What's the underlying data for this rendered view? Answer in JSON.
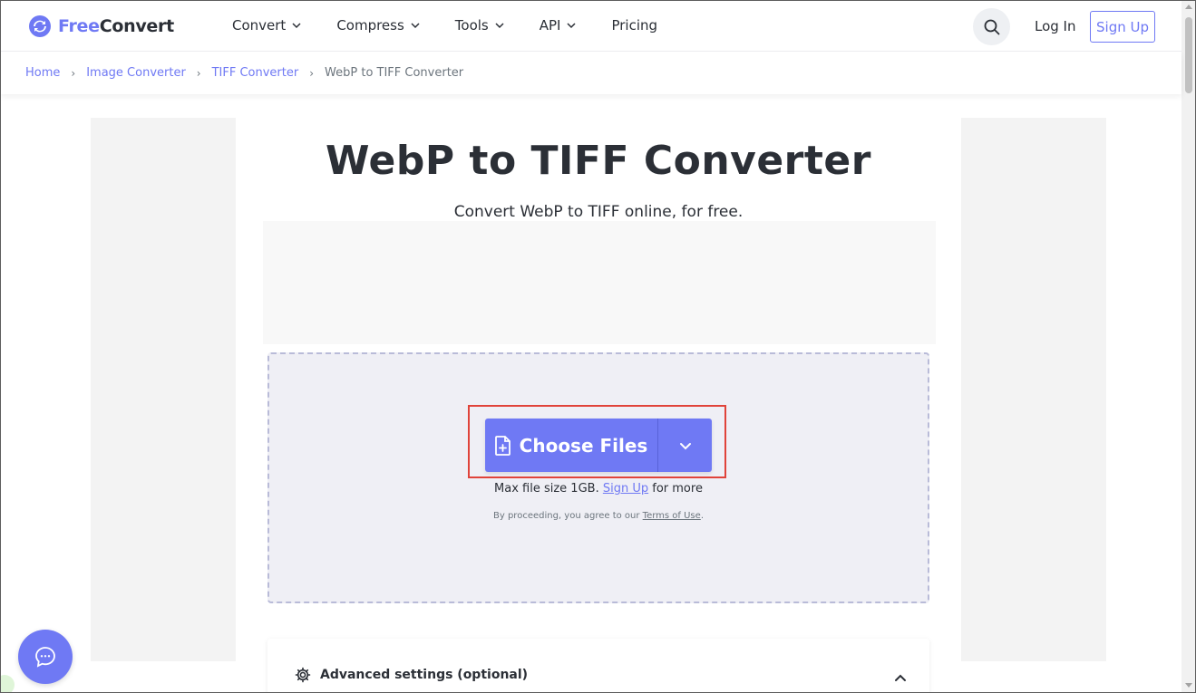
{
  "brand": {
    "name_part1": "Free",
    "name_part2": "Convert",
    "accent": "#6f79f4"
  },
  "nav": {
    "items": [
      {
        "label": "Convert",
        "has_dropdown": true
      },
      {
        "label": "Compress",
        "has_dropdown": true
      },
      {
        "label": "Tools",
        "has_dropdown": true
      },
      {
        "label": "API",
        "has_dropdown": true
      },
      {
        "label": "Pricing",
        "has_dropdown": false
      }
    ],
    "login_label": "Log In",
    "signup_label": "Sign Up"
  },
  "breadcrumb": {
    "items": [
      "Home",
      "Image Converter",
      "TIFF Converter",
      "WebP to TIFF Converter"
    ]
  },
  "main": {
    "title": "WebP to TIFF Converter",
    "subtitle": "Convert WebP to TIFF online, for free."
  },
  "upload": {
    "button_label": "Choose Files",
    "max_size_text": "Max file size 1GB.",
    "signup_link": "Sign Up",
    "max_size_suffix": "for more",
    "terms_prefix": "By proceeding, you agree to our",
    "terms_link": "Terms of Use",
    "terms_suffix": "."
  },
  "advanced": {
    "label": "Advanced settings (optional)"
  },
  "icons": {
    "search": "search-icon",
    "chat": "chat-icon",
    "settings": "gear-icon",
    "file_add": "file-plus-icon"
  },
  "colors": {
    "highlight": "#e0433a",
    "dropzone_bg": "#efeff5"
  }
}
